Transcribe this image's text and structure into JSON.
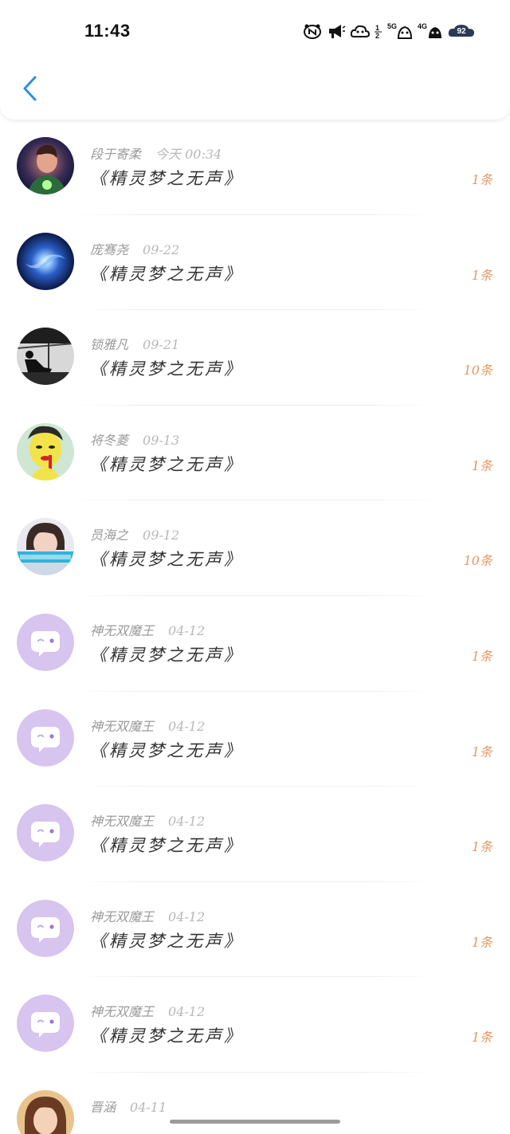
{
  "status_bar": {
    "time": "11:43",
    "network_1": "5G",
    "network_2": "4G",
    "battery": "92",
    "icons": [
      "notification-n-icon",
      "megaphone-icon",
      "cloud-cat-icon",
      "signal-5g-icon",
      "signal-4g-icon",
      "battery-icon"
    ]
  },
  "header": {
    "back_icon": "chevron-left-icon",
    "accent": "#2e8ee6"
  },
  "colors": {
    "count": "#e39a66",
    "default_avatar_bg": "#d7c4ef"
  },
  "messages": [
    {
      "name": "段于寄柔",
      "time": "今天 00:34",
      "title": "《精灵梦之无声》",
      "count": "1条",
      "avatar": "photo-boy-avatar"
    },
    {
      "name": "庞骞尧",
      "time": "09-22",
      "title": "《精灵梦之无声》",
      "count": "1条",
      "avatar": "galaxy-avatar"
    },
    {
      "name": "锁雅凡",
      "time": "09-21",
      "title": "《精灵梦之无声》",
      "count": "10条",
      "avatar": "bw-window-avatar"
    },
    {
      "name": "将冬菱",
      "time": "09-13",
      "title": "《精灵梦之无声》",
      "count": "1条",
      "avatar": "yellow-face-avatar"
    },
    {
      "name": "员海之",
      "time": "09-12",
      "title": "《精灵梦之无声》",
      "count": "10条",
      "avatar": "girl-cyan-avatar"
    },
    {
      "name": "神无双魔王",
      "time": "04-12",
      "title": "《精灵梦之无声》",
      "count": "1条",
      "avatar": "default-chat-avatar"
    },
    {
      "name": "神无双魔王",
      "time": "04-12",
      "title": "《精灵梦之无声》",
      "count": "1条",
      "avatar": "default-chat-avatar"
    },
    {
      "name": "神无双魔王",
      "time": "04-12",
      "title": "《精灵梦之无声》",
      "count": "1条",
      "avatar": "default-chat-avatar"
    },
    {
      "name": "神无双魔王",
      "time": "04-12",
      "title": "《精灵梦之无声》",
      "count": "1条",
      "avatar": "default-chat-avatar"
    },
    {
      "name": "神无双魔王",
      "time": "04-12",
      "title": "《精灵梦之无声》",
      "count": "1条",
      "avatar": "default-chat-avatar"
    },
    {
      "name": "晋涵",
      "time": "04-11",
      "title": "",
      "count": "",
      "avatar": "photo-girl-avatar"
    }
  ]
}
